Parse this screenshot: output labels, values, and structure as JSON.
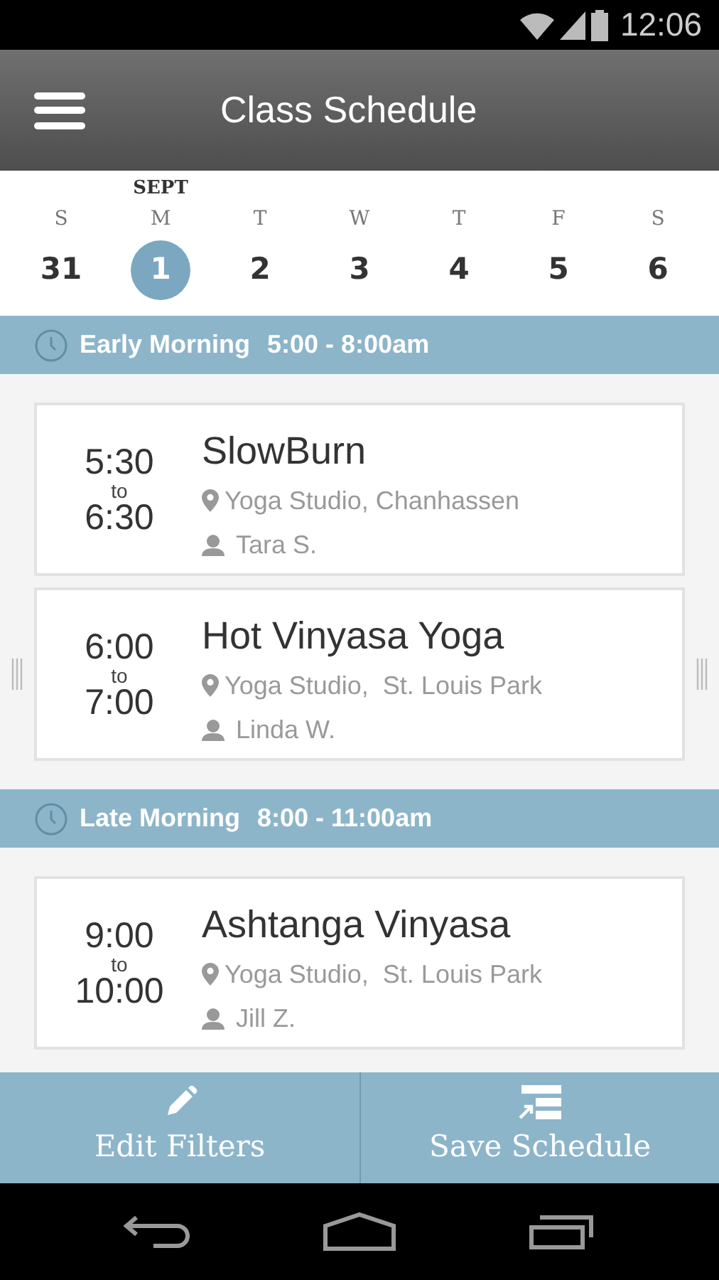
{
  "status_bar": {
    "time": "12:06"
  },
  "header": {
    "title": "Class Schedule"
  },
  "calendar": {
    "days": [
      {
        "weekday": "S",
        "date": "31",
        "selected": false
      },
      {
        "month": "SEPT",
        "weekday": "M",
        "date": "1",
        "selected": true
      },
      {
        "weekday": "T",
        "date": "2",
        "selected": false
      },
      {
        "weekday": "W",
        "date": "3",
        "selected": false
      },
      {
        "weekday": "T",
        "date": "4",
        "selected": false
      },
      {
        "weekday": "F",
        "date": "5",
        "selected": false
      },
      {
        "weekday": "S",
        "date": "6",
        "selected": false
      }
    ]
  },
  "sections": [
    {
      "title": "Early Morning",
      "hours": "5:00 - 8:00am",
      "classes": [
        {
          "start": "5:30",
          "to": "to",
          "end": "6:30",
          "name": "SlowBurn",
          "location": "Yoga Studio, Chanhassen",
          "instructor": "Tara S.",
          "handles": false
        },
        {
          "start": "6:00",
          "to": "to",
          "end": "7:00",
          "name": "Hot Vinyasa Yoga",
          "location": "Yoga Studio,  St. Louis Park",
          "instructor": "Linda W.",
          "handles": true
        }
      ]
    },
    {
      "title": "Late Morning",
      "hours": "8:00 - 11:00am",
      "classes": [
        {
          "start": "9:00",
          "to": "to",
          "end": "10:00",
          "name": "Ashtanga Vinyasa",
          "location": "Yoga Studio,  St. Louis Park",
          "instructor": "Jill Z.",
          "handles": false
        }
      ]
    }
  ],
  "actions": [
    {
      "kind": "edit",
      "label": "Edit Filters"
    },
    {
      "kind": "save",
      "label": "Save Schedule"
    }
  ]
}
